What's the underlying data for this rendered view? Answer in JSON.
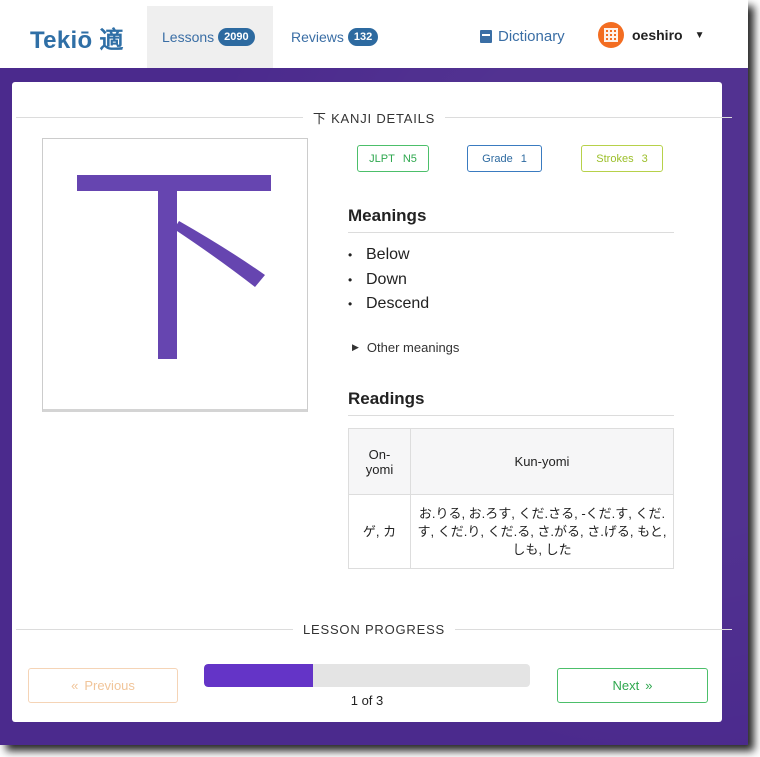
{
  "nav": {
    "logo": "Tekiō 適",
    "lessons_label": "Lessons",
    "lessons_count": "2090",
    "reviews_label": "Reviews",
    "reviews_count": "132",
    "dictionary_label": "Dictionary",
    "username": "oeshiro"
  },
  "kanji_details": {
    "heading": "下 KANJI DETAILS",
    "character": "下",
    "badges": {
      "jlpt_label": "JLPT",
      "jlpt_value": "N5",
      "grade_label": "Grade",
      "grade_value": "1",
      "strokes_label": "Strokes",
      "strokes_value": "3"
    },
    "meanings_title": "Meanings",
    "meanings": [
      "Below",
      "Down",
      "Descend"
    ],
    "other_meanings_label": "Other meanings",
    "readings_title": "Readings",
    "readings": {
      "on_header": "On-yomi",
      "kun_header": "Kun-yomi",
      "on_value": "ゲ, カ",
      "kun_value": "お.りる, お.ろす, くだ.さる, -くだ.す, くだ.す, くだ.り, くだ.る, さ.がる, さ.げる, もと, しも, した"
    }
  },
  "progress": {
    "heading": "LESSON PROGRESS",
    "current": 1,
    "total": 3,
    "text": "1 of 3",
    "previous_label": "Previous",
    "next_label": "Next"
  },
  "colors": {
    "brand_blue": "#2f6fa6",
    "purple_bg": "#4b2a8d",
    "kanji_stroke": "#6645b0",
    "progress_fill": "#6434c7",
    "jlpt_green": "#2fa84f",
    "strokes_lime": "#9cbf2a",
    "avatar_orange": "#f36d21"
  },
  "icons": {
    "dictionary": "book-icon",
    "previous": "double-chevron-left-icon",
    "next": "double-chevron-right-icon",
    "other_meanings": "caret-right-icon",
    "user_menu": "caret-down-icon"
  }
}
